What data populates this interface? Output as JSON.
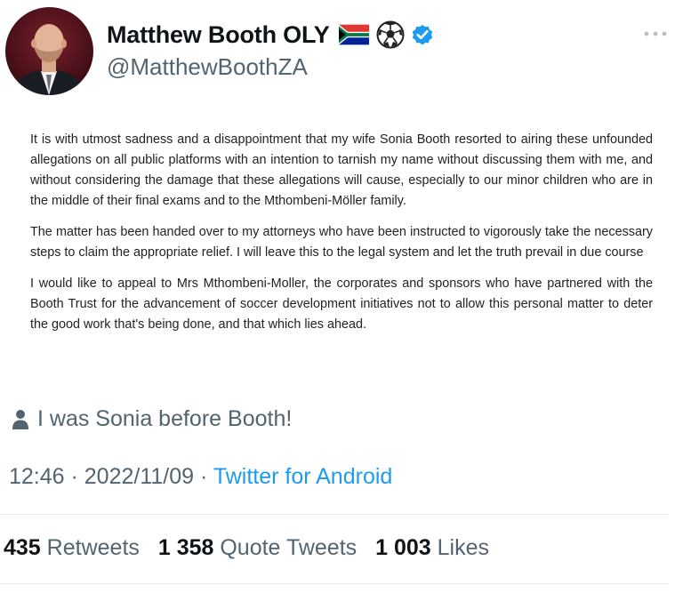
{
  "user": {
    "display_name": "Matthew Booth OLY",
    "handle": "@MatthewBoothZA"
  },
  "icons": {
    "flag": "south-africa-flag-icon",
    "ball": "soccer-ball-icon",
    "verified": "verified-badge-icon",
    "more": "more-options-icon",
    "hint": "person-icon"
  },
  "colors": {
    "link": "#1d9bf0",
    "muted": "#536471",
    "text": "#0f1419"
  },
  "statement": {
    "paragraphs": [
      "It is with utmost sadness and a disappointment that my wife Sonia Booth resorted to airing these unfounded allegations on all public platforms with an intention to tarnish my name without discussing them with me, and without considering the damage that these allegations will cause, especially to our minor children who are in the middle of their final exams and to the Mthombeni-Möller family.",
      "The matter has been handed over to my attorneys who have been instructed to vigorously take the necessary steps to claim the appropriate relief. I will leave this to the legal system and let the truth prevail in due course",
      "I would like to appeal to Mrs Mthombeni-Moller, the corporates and sponsors who have partnered with the Booth Trust for the advancement of soccer development initiatives not to allow this personal matter to deter the good work that's being done, and that which lies ahead."
    ]
  },
  "image_hint": "I was Sonia before Booth!",
  "meta": {
    "time": "12:46",
    "separator": " · ",
    "date": "2022/11/09",
    "source": "Twitter for Android"
  },
  "stats": {
    "retweets": {
      "count": "435",
      "label": "Retweets"
    },
    "quotes": {
      "count": "1 358",
      "label": "Quote Tweets"
    },
    "likes": {
      "count": "1 003",
      "label": "Likes"
    }
  }
}
